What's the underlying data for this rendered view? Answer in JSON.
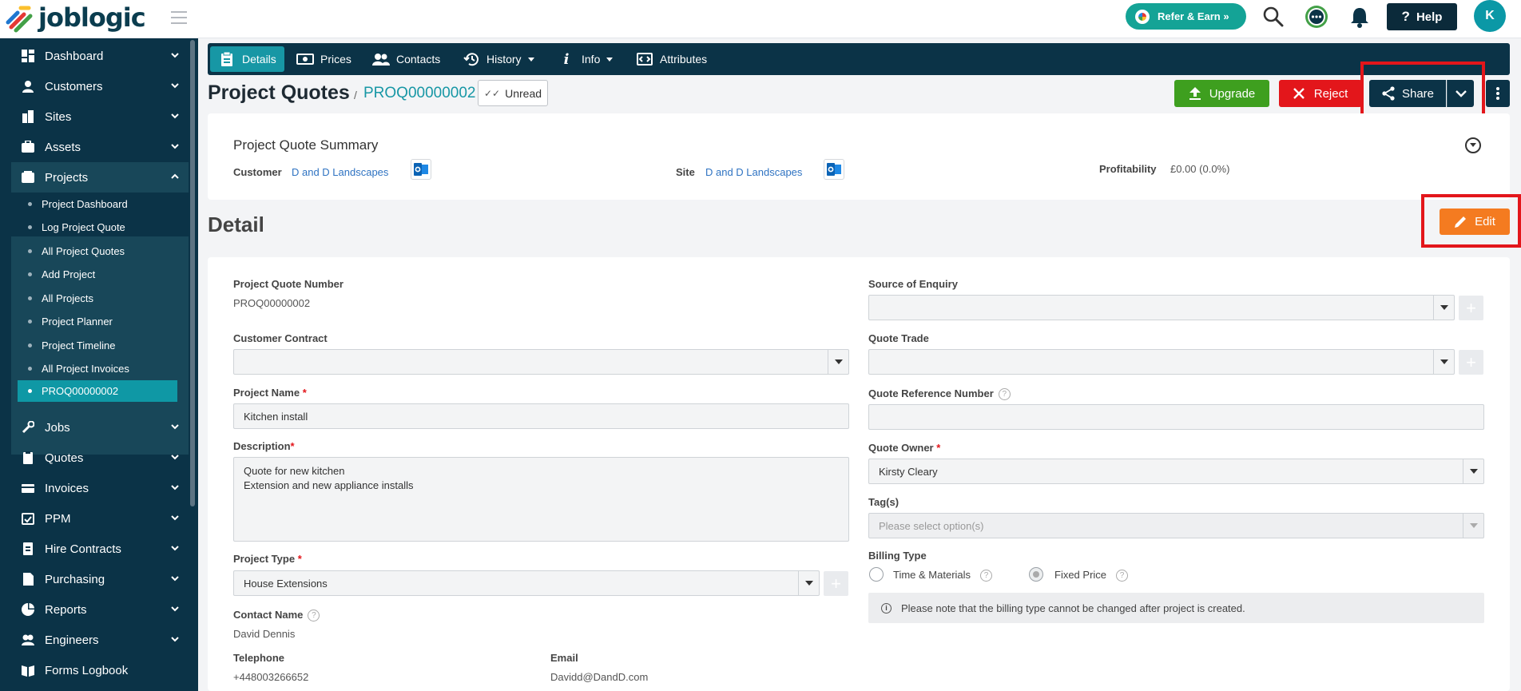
{
  "header": {
    "logo_text": "joblogic",
    "refer_label": "Refer & Earn »",
    "help_label": "Help",
    "avatar_initial": "K"
  },
  "sidebar": {
    "items": [
      {
        "label": "Dashboard",
        "icon": "dashboard-icon"
      },
      {
        "label": "Customers",
        "icon": "customers-icon"
      },
      {
        "label": "Sites",
        "icon": "sites-icon"
      },
      {
        "label": "Assets",
        "icon": "assets-icon"
      },
      {
        "label": "Projects",
        "icon": "projects-icon"
      },
      {
        "label": "Jobs",
        "icon": "jobs-icon"
      },
      {
        "label": "Quotes",
        "icon": "quotes-icon"
      },
      {
        "label": "Invoices",
        "icon": "invoices-icon"
      },
      {
        "label": "PPM",
        "icon": "ppm-icon"
      },
      {
        "label": "Hire Contracts",
        "icon": "hire-contracts-icon"
      },
      {
        "label": "Purchasing",
        "icon": "purchasing-icon"
      },
      {
        "label": "Reports",
        "icon": "reports-icon"
      },
      {
        "label": "Engineers",
        "icon": "engineers-icon"
      },
      {
        "label": "Forms Logbook",
        "icon": "forms-logbook-icon"
      }
    ],
    "project_sub_items": [
      "Project Dashboard",
      "Log Project Quote",
      "All Project Quotes",
      "Add Project",
      "All Projects",
      "Project Planner",
      "Project Timeline",
      "All Project Invoices",
      "PROQ00000002"
    ]
  },
  "tabs": [
    {
      "label": "Details",
      "icon": "details-icon"
    },
    {
      "label": "Prices",
      "icon": "prices-icon"
    },
    {
      "label": "Contacts",
      "icon": "contacts-icon"
    },
    {
      "label": "History",
      "icon": "history-icon"
    },
    {
      "label": "Info",
      "icon": "info-icon"
    },
    {
      "label": "Attributes",
      "icon": "attributes-icon"
    }
  ],
  "page": {
    "title": "Project Quotes",
    "separator": "/",
    "reference": "PROQ00000002",
    "unread_label": "Unread",
    "upgrade_label": "Upgrade",
    "reject_label": "Reject",
    "share_label": "Share",
    "edit_label": "Edit",
    "detail_heading": "Detail"
  },
  "summary": {
    "title": "Project Quote Summary",
    "customer_label": "Customer",
    "customer_value": "D and D Landscapes",
    "site_label": "Site",
    "site_value": "D and D Landscapes",
    "profitability_label": "Profitability",
    "profitability_value": "£0.00 (0.0%)"
  },
  "form": {
    "quote_number_label": "Project Quote Number",
    "quote_number_value": "PROQ00000002",
    "customer_contract_label": "Customer Contract",
    "customer_contract_value": "",
    "project_name_label": "Project Name",
    "project_name_value": "Kitchen install",
    "description_label": "Description",
    "description_line1": "Quote for new kitchen",
    "description_line2": "Extension and new appliance installs",
    "project_type_label": "Project Type",
    "project_type_value": "House Extensions",
    "contact_name_label": "Contact Name",
    "contact_name_value": "David Dennis",
    "telephone_label": "Telephone",
    "telephone_value": "+448003266652",
    "email_label": "Email",
    "email_value": "Davidd@DandD.com",
    "source_label": "Source of Enquiry",
    "source_value": "",
    "quote_trade_label": "Quote Trade",
    "quote_trade_value": "",
    "quote_ref_label": "Quote Reference Number",
    "quote_ref_value": "",
    "quote_owner_label": "Quote Owner",
    "quote_owner_value": "Kirsty Cleary",
    "tags_label": "Tag(s)",
    "tags_placeholder": "Please select option(s)",
    "billing_type_label": "Billing Type",
    "billing_option_1": "Time & Materials",
    "billing_option_2": "Fixed Price",
    "billing_selected": "Fixed Price",
    "billing_note": "Please note that the billing type cannot be changed after project is created.",
    "required_mark": "*",
    "help_mark": "?"
  },
  "colors": {
    "sidebar_bg": "#0b3347",
    "accent_teal": "#1797a5",
    "upgrade_green": "#3e9f1f",
    "reject_red": "#e3161b",
    "edit_orange": "#f47b20",
    "highlight_red": "#e3161b"
  }
}
